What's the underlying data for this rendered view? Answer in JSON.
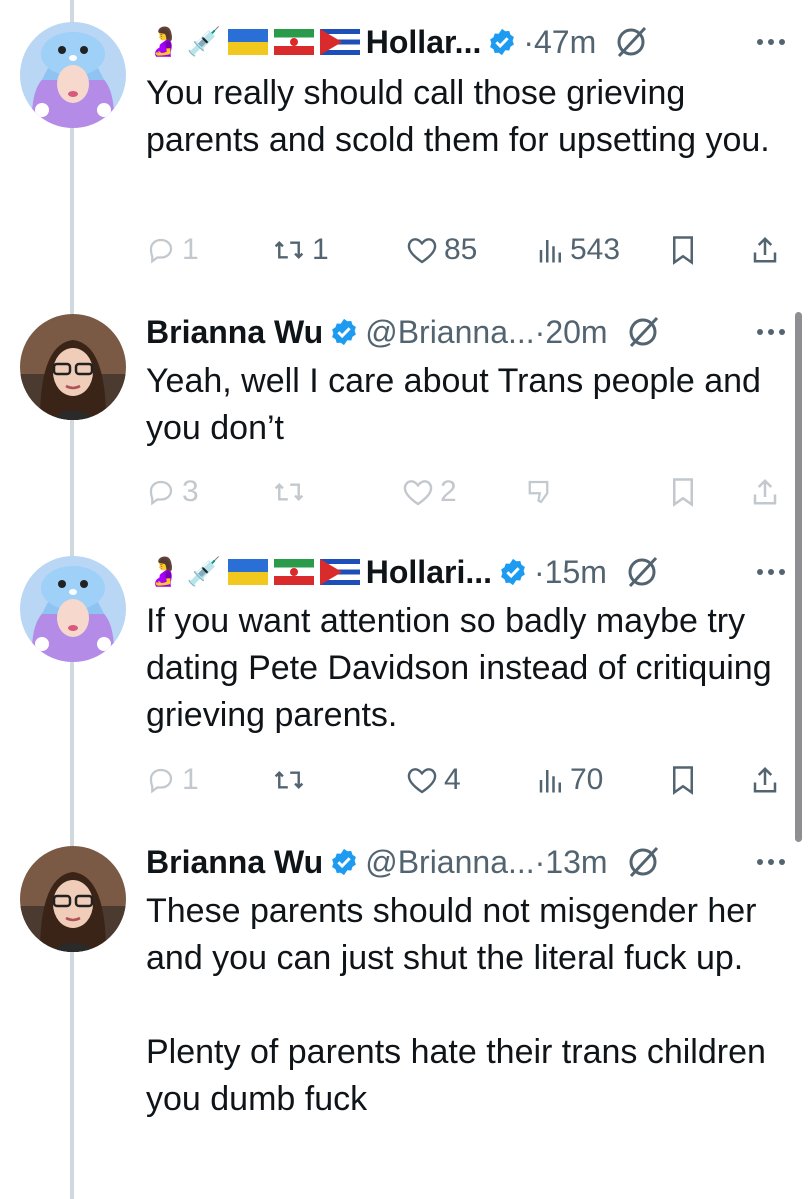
{
  "tweets": [
    {
      "id": "tweet-1",
      "author_type": "hollar",
      "badges": [
        "pregnant-man-emoji",
        "syringe-emoji",
        "ukraine-flag",
        "iran-flag",
        "cuba-flag"
      ],
      "name": "Hollar...",
      "handle": "",
      "time": "·47m",
      "text": "You really should call those grieving parents and scold them for upsetting you.",
      "actions": {
        "replies": "1",
        "retweets": "1",
        "likes": "85",
        "views": "543"
      }
    },
    {
      "id": "tweet-2",
      "author_type": "brianna",
      "name": "Brianna Wu",
      "handle": "@Brianna...",
      "time": "·20m",
      "text": "Yeah, well I care about Trans people and you don’t",
      "actions": {
        "replies": "3",
        "retweets": "",
        "likes": "2",
        "views": ""
      }
    },
    {
      "id": "tweet-3",
      "author_type": "hollar",
      "badges": [
        "pregnant-man-emoji",
        "syringe-emoji",
        "ukraine-flag",
        "iran-flag",
        "cuba-flag"
      ],
      "name": "Hollari...",
      "handle": "",
      "time": "·15m",
      "text": "If you want attention so badly maybe try dating Pete Davidson instead of critiquing grieving parents.",
      "actions": {
        "replies": "1",
        "retweets": "",
        "likes": "4",
        "views": "70"
      }
    },
    {
      "id": "tweet-4",
      "author_type": "brianna",
      "name": "Brianna Wu",
      "handle": "@Brianna...",
      "time": "·13m",
      "text": "These parents should not misgender her and you can just shut the literal fuck up.\n\nPlenty of parents hate their trans children you dumb fuck",
      "actions": {
        "replies": "",
        "retweets": "",
        "likes": "",
        "views": ""
      }
    }
  ],
  "colors": {
    "accent": "#1d9bf0",
    "muted": "#536471",
    "text": "#0f1419",
    "thread": "#cfd9de"
  },
  "icons": {
    "reply": "reply-icon",
    "retweet": "retweet-icon",
    "like": "heart-icon",
    "views": "views-icon",
    "bookmark": "bookmark-icon",
    "share": "share-icon",
    "verified": "verified-badge-icon",
    "mute": "mute-icon",
    "more": "more-icon"
  }
}
